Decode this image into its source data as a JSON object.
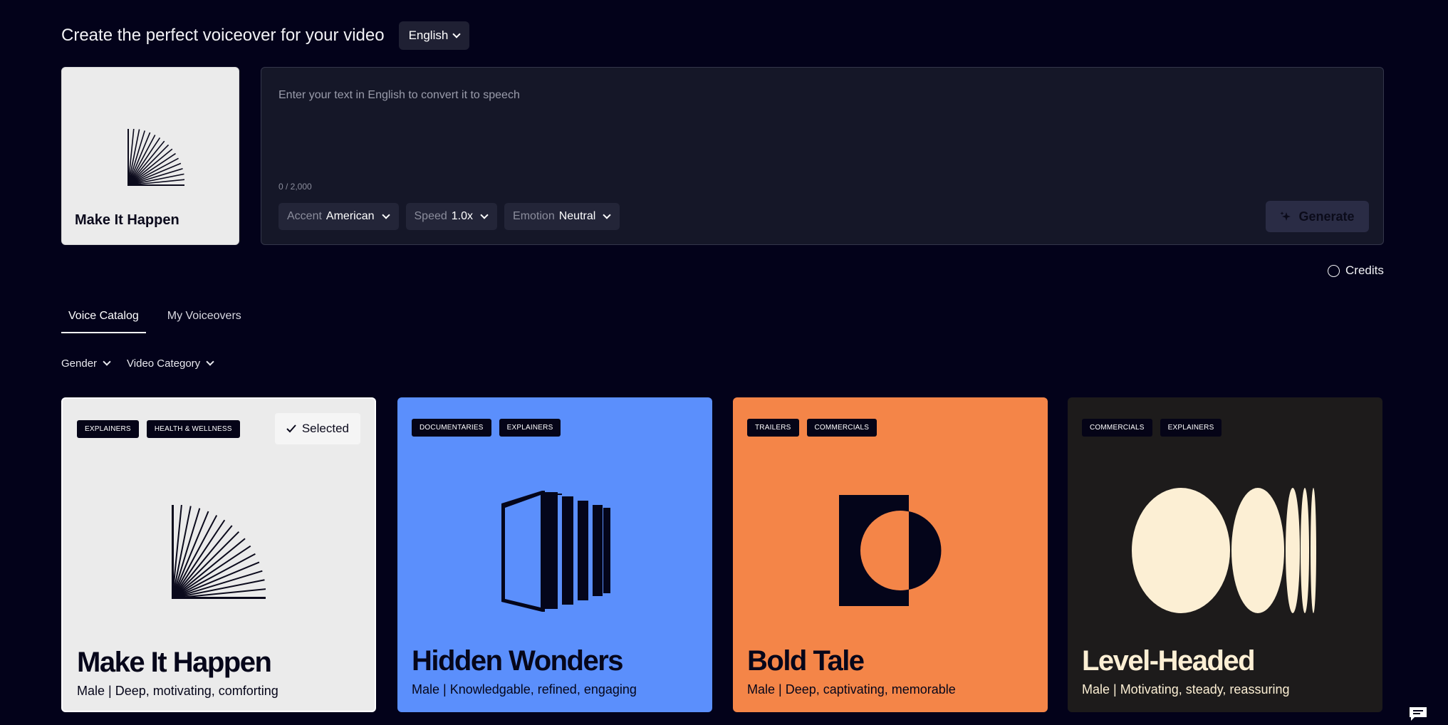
{
  "header": {
    "title": "Create the perfect voiceover for your video",
    "language": "English"
  },
  "selected_voice": {
    "name": "Make It Happen"
  },
  "editor": {
    "placeholder": "Enter your text in English to convert it to speech",
    "char_count": "0 / 2,000",
    "accent": {
      "label": "Accent",
      "value": "American"
    },
    "speed": {
      "label": "Speed",
      "value": "1.0x"
    },
    "emotion": {
      "label": "Emotion",
      "value": "Neutral"
    },
    "generate_label": "Generate"
  },
  "credits": {
    "label": "Credits"
  },
  "tabs": [
    {
      "label": "Voice Catalog",
      "active": true
    },
    {
      "label": "My Voiceovers",
      "active": false
    }
  ],
  "filters": [
    {
      "label": "Gender"
    },
    {
      "label": "Video Category"
    }
  ],
  "cards": [
    {
      "name": "Make It Happen",
      "desc": "Male | Deep, motivating, comforting",
      "tags": [
        "EXPLAINERS",
        "HEALTH & WELLNESS"
      ],
      "bg": "#ebebeb",
      "selected_label": "Selected"
    },
    {
      "name": "Hidden Wonders",
      "desc": "Male | Knowledgable, refined, engaging",
      "tags": [
        "DOCUMENTARIES",
        "EXPLAINERS"
      ],
      "bg": "#5b8ffc"
    },
    {
      "name": "Bold Tale",
      "desc": "Male | Deep, captivating, memorable",
      "tags": [
        "TRAILERS",
        "COMMERCIALS"
      ],
      "bg": "#f48548"
    },
    {
      "name": "Level-Headed",
      "desc": "Male | Motivating, steady, reassuring",
      "tags": [
        "COMMERCIALS",
        "EXPLAINERS"
      ],
      "bg": "#1d1b1b"
    }
  ],
  "icons": {
    "sparkle": "sparkle-icon",
    "chat": "chat-icon",
    "check": "check-icon"
  }
}
